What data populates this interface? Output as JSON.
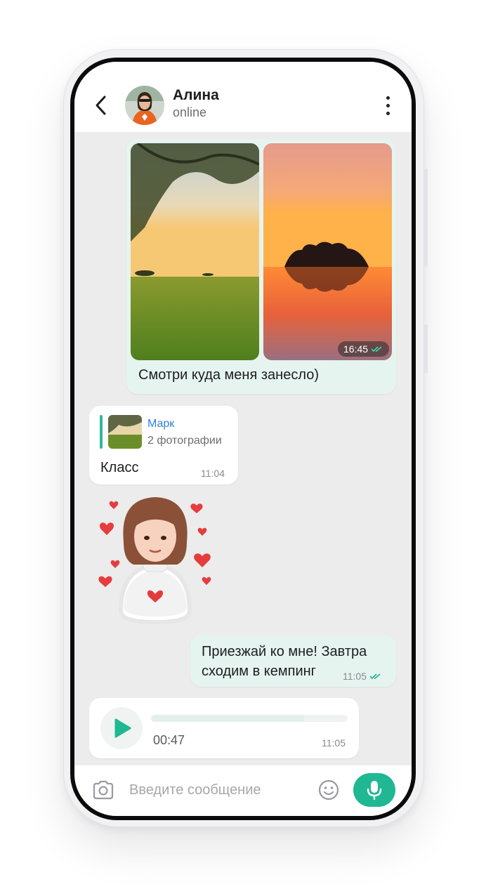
{
  "header": {
    "contact_name": "Алина",
    "contact_status": "online",
    "back_icon": "chevron-left-icon",
    "menu_icon": "more-vertical-icon"
  },
  "messages": {
    "photos": {
      "time": "16:45",
      "status_icon": "double-check-icon",
      "caption": "Смотри куда меня занесло)"
    },
    "reply": {
      "quoted_author": "Марк",
      "quoted_description": "2 фотографии",
      "text": "Класс",
      "time": "11:04"
    },
    "sticker": {
      "icon": "girl-hearts-sticker"
    },
    "outgoing_text": {
      "text": "Приезжай ко мне! Завтра сходим в кемпинг",
      "time": "11:05",
      "status_icon": "double-check-icon"
    },
    "voice": {
      "duration": "00:47",
      "time": "11:05",
      "progress": 0.78,
      "play_icon": "play-icon"
    }
  },
  "composer": {
    "placeholder": "Введите сообщение",
    "camera_icon": "camera-icon",
    "emoji_icon": "smile-icon",
    "mic_icon": "microphone-icon"
  },
  "colors": {
    "accent": "#1fb893",
    "outgoing_bubble": "#e6f4f0",
    "incoming_bubble": "#ffffff",
    "chat_background": "#ececec",
    "link": "#2f7de0"
  }
}
